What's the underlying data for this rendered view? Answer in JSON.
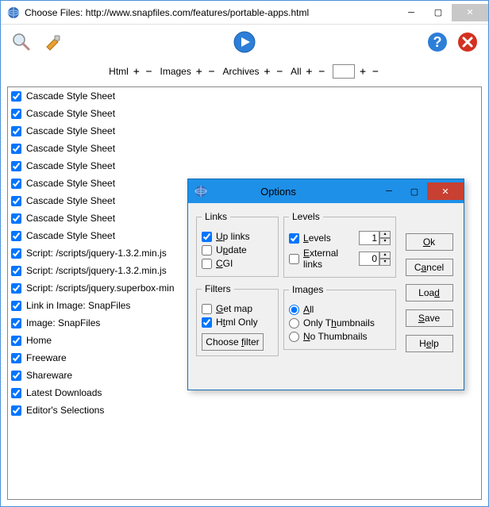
{
  "window": {
    "title": "Choose Files: http://www.snapfiles.com/features/portable-apps.html"
  },
  "filterbar": {
    "html": "Html",
    "images": "Images",
    "archives": "Archives",
    "all": "All",
    "plus": "+",
    "minus": "−"
  },
  "list": [
    "Cascade Style Sheet",
    "Cascade Style Sheet",
    "Cascade Style Sheet",
    "Cascade Style Sheet",
    "Cascade Style Sheet",
    "Cascade Style Sheet",
    "Cascade Style Sheet",
    "Cascade Style Sheet",
    "Cascade Style Sheet",
    "Script: /scripts/jquery-1.3.2.min.js",
    "Script: /scripts/jquery-1.3.2.min.js",
    "Script: /scripts/jquery.superbox-min",
    "Link in Image: SnapFiles",
    "Image: SnapFiles",
    "Home",
    "Freeware",
    "Shareware",
    "Latest Downloads",
    "Editor's Selections"
  ],
  "dialog": {
    "title": "Options",
    "links": {
      "legend": "Links",
      "uplinks": "Up links",
      "update": "Update",
      "cgi": "CGI"
    },
    "filters": {
      "legend": "Filters",
      "getmap": "Get map",
      "htmlonly": "Html Only",
      "choose": "Choose filter"
    },
    "levels": {
      "legend": "Levels",
      "levels": "Levels",
      "levels_val": "1",
      "external": "External links",
      "external_val": "0"
    },
    "images": {
      "legend": "Images",
      "all": "All",
      "onlythumbs": "Only Thumbnails",
      "nothumbs": "No Thumbnails"
    },
    "buttons": {
      "ok": "Ok",
      "cancel": "Cancel",
      "load": "Load",
      "save": "Save",
      "help": "Help"
    }
  }
}
